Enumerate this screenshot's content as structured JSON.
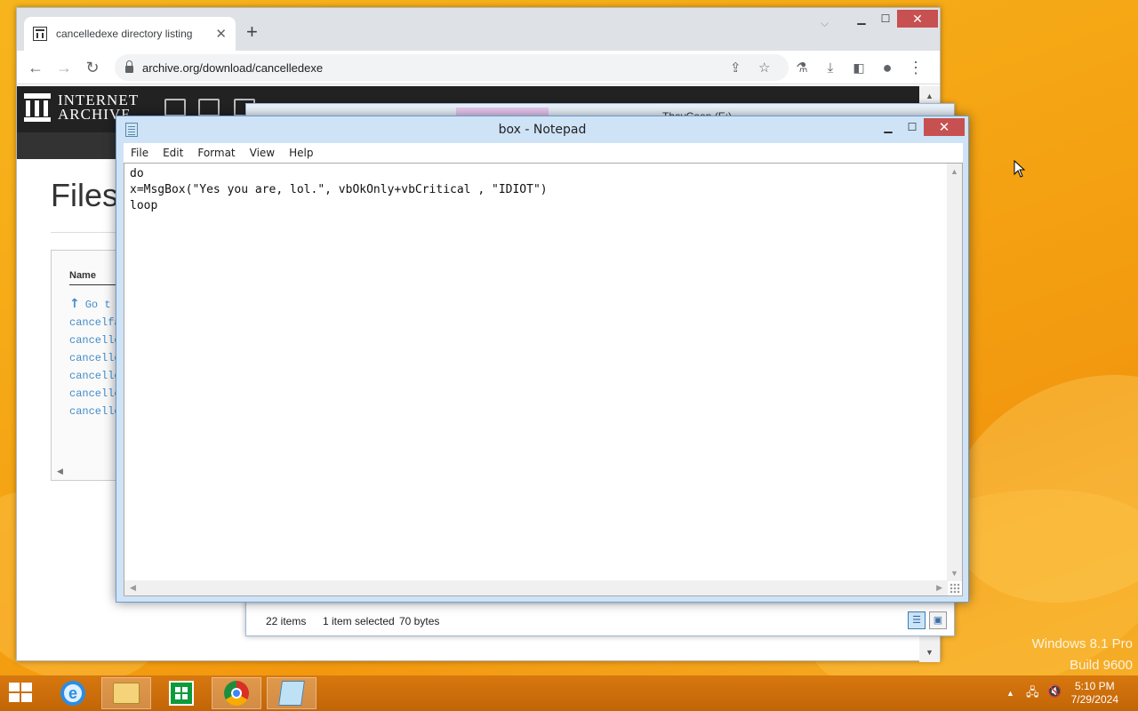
{
  "browser": {
    "tab_title": "cancelledexe directory listing",
    "tab_close": "✕",
    "new_tab": "+",
    "url": "archive.org/download/cancelledexe",
    "tab_search": "⌵",
    "min": "▁",
    "max": "☐",
    "close": "✕"
  },
  "ia": {
    "logo_line1": "INTERNET",
    "logo_line2": "ARCHIVE",
    "files_title": "Files",
    "col_name": "Name",
    "go_up": "Go t",
    "files": [
      "cancelfa",
      "cancelle",
      "cancelle",
      "cancelle",
      "cancelle",
      "cancelle"
    ]
  },
  "explorer": {
    "title": "ThayCoon (E:)",
    "items_count": "22 items",
    "selected": "1 item selected",
    "size": "70 bytes"
  },
  "notepad": {
    "title": "box - Notepad",
    "menu": [
      "File",
      "Edit",
      "Format",
      "View",
      "Help"
    ],
    "lines": [
      "do",
      "x=MsgBox(\"Yes you are, lol.\", vbOkOnly+vbCritical , \"IDIOT\")",
      "loop"
    ],
    "min": "▁",
    "max": "☐",
    "close": "✕"
  },
  "watermark": {
    "line1": "Windows 8.1 Pro",
    "line2": "Build 9600"
  },
  "taskbar": {
    "time": "5:10 PM",
    "date": "7/29/2024",
    "tray_up": "▲",
    "ie_letter": "e"
  }
}
